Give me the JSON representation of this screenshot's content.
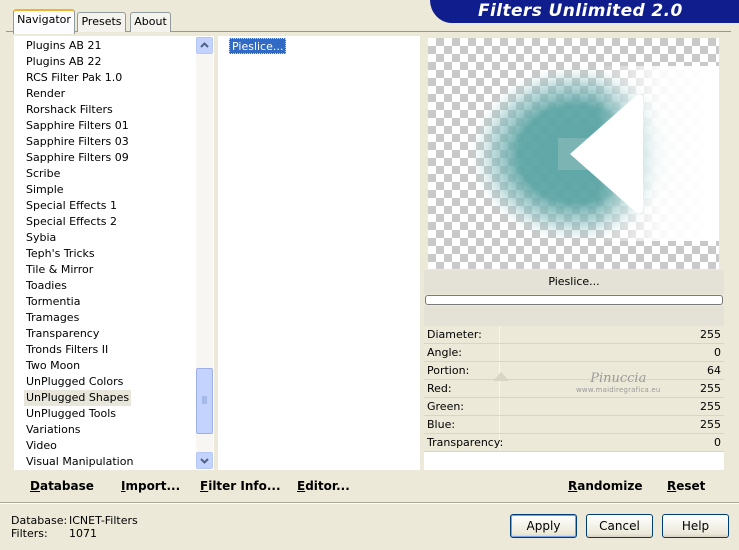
{
  "window": {
    "banner_title": "Filters Unlimited 2.0",
    "accent_color": "#0f1e8c",
    "selection_color": "#316ac5"
  },
  "tabs": [
    {
      "label": "Navigator",
      "active": true
    },
    {
      "label": "Presets",
      "active": false
    },
    {
      "label": "About",
      "active": false
    }
  ],
  "categories": {
    "items": [
      "Plugins AB 21",
      "Plugins AB 22",
      "RCS Filter Pak 1.0",
      "Render",
      "Rorshack Filters",
      "Sapphire Filters 01",
      "Sapphire Filters 03",
      "Sapphire Filters 09",
      "Scribe",
      "Simple",
      "Special Effects 1",
      "Special Effects 2",
      "Sybia",
      "Teph's Tricks",
      "Tile & Mirror",
      "Toadies",
      "Tormentia",
      "Tramages",
      "Transparency",
      "Tronds Filters II",
      "Two Moon",
      "UnPlugged Colors",
      "UnPlugged Shapes",
      "UnPlugged Tools",
      "Variations",
      "Video",
      "Visual Manipulation"
    ],
    "selected": "UnPlugged Shapes"
  },
  "filters": {
    "items": [
      "Pieslice..."
    ],
    "selected": "Pieslice..."
  },
  "preview": {
    "filter_name": "Pieslice...",
    "progress": 0
  },
  "params": [
    {
      "label": "Diameter:",
      "value": "255"
    },
    {
      "label": "Angle:",
      "value": "0"
    },
    {
      "label": "Portion:",
      "value": "64"
    },
    {
      "label": "Red:",
      "value": "255"
    },
    {
      "label": "Green:",
      "value": "255"
    },
    {
      "label": "Blue:",
      "value": "255"
    },
    {
      "label": "Transparency:",
      "value": "0"
    }
  ],
  "watermark": {
    "title": "Pinuccia",
    "subtitle": "www.maidiregrafica.eu"
  },
  "actions": {
    "database": "Database",
    "import": "Import...",
    "filter_info": "Filter Info...",
    "editor": "Editor...",
    "randomize": "Randomize",
    "reset": "Reset"
  },
  "status": {
    "database_label": "Database:",
    "database_value": "ICNET-Filters",
    "filters_label": "Filters:",
    "filters_value": "1071"
  },
  "buttons": {
    "apply": "Apply",
    "cancel": "Cancel",
    "help": "Help"
  }
}
